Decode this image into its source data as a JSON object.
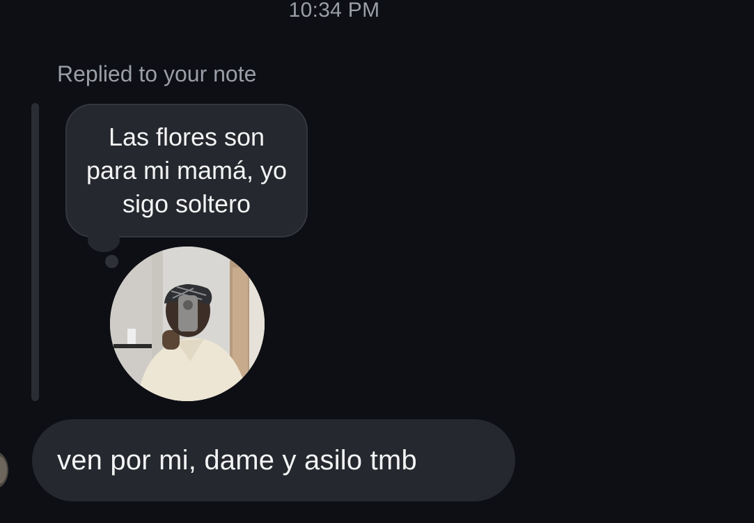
{
  "header": {
    "timestamp": "10:34 PM"
  },
  "reply_context": {
    "label": "Replied to your note",
    "note_text": "Las flores son para mi mamá, yo sigo soltero",
    "avatar": "profile-photo"
  },
  "message": {
    "text": "ven por mi, dame y asilo tmb",
    "sender_avatar": "sender-avatar"
  },
  "colors": {
    "background": "#0d0f14",
    "bubble": "#25282e",
    "secondary_text": "#9a9ea6",
    "primary_text": "#f4f4f5"
  }
}
